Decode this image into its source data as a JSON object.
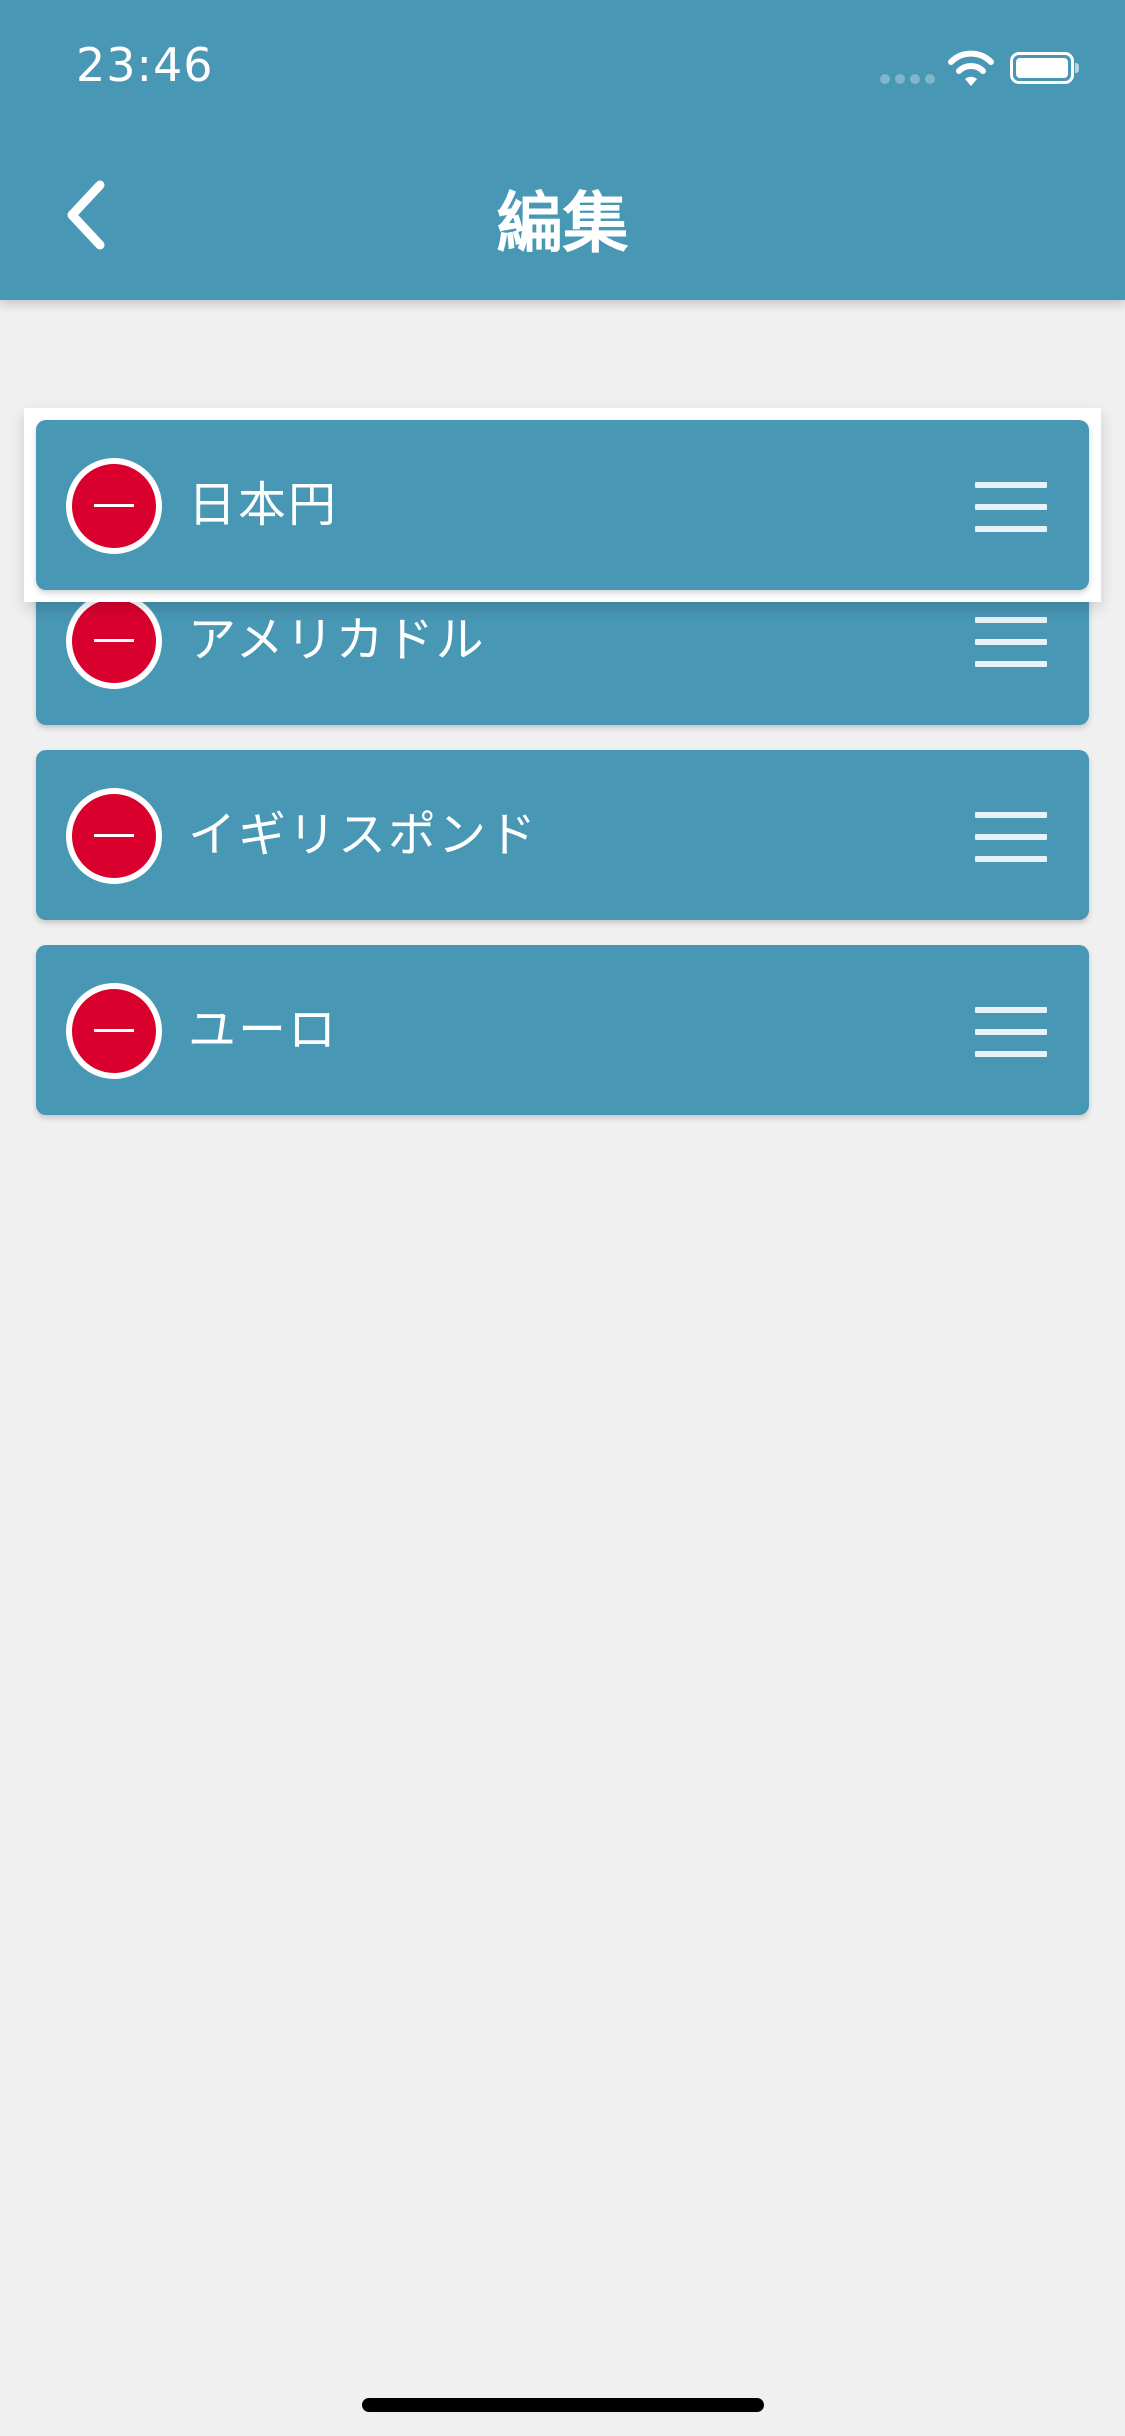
{
  "status_bar": {
    "time": "23:46"
  },
  "header": {
    "title": "編集",
    "back_icon": "chevron-left-icon"
  },
  "currency_list": {
    "items": [
      {
        "label": "日本円",
        "state": "dragging"
      },
      {
        "label": "アメリカドル"
      },
      {
        "label": "イギリスポンド"
      },
      {
        "label": "ユーロ"
      }
    ],
    "delete_icon": "minus-circle-icon",
    "reorder_icon": "drag-handle-icon"
  },
  "colors": {
    "primary": "#4897b5",
    "delete": "#d9002e",
    "background": "#f0f0f0"
  }
}
